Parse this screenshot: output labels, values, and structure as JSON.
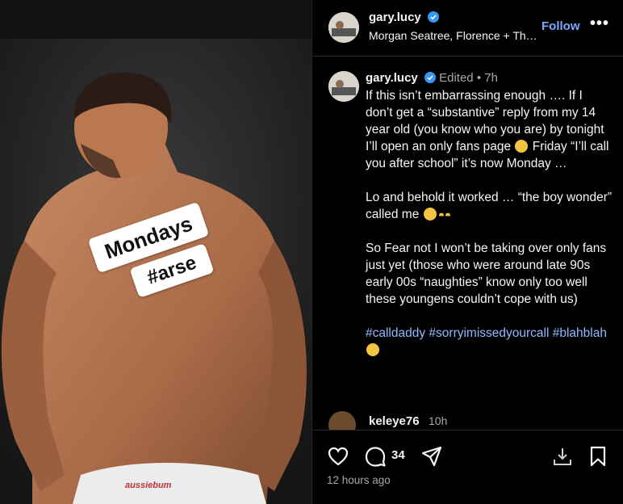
{
  "post": {
    "sticker_line1": "Mondays",
    "sticker_line2": "#arse"
  },
  "header": {
    "username": "gary.lucy",
    "location": "Morgan Seatree, Florence + Th…",
    "follow_label": "Follow",
    "more_label": "•••"
  },
  "caption": {
    "username": "gary.lucy",
    "edited": "Edited",
    "separator": "•",
    "time": "7h",
    "para1": "If this isn’t embarrassing enough …. If I don’t get a “substantive” reply from my 14 year old (you know who you are) by tonight I’ll open an only fans page",
    "para1b": "Friday “I’ll call you after school” it’s now Monday …",
    "para2": "Lo and behold it worked … “the boy wonder” called me",
    "para3": "So Fear not I won’t be taking over only fans just yet (those who were around late 90s early 00s “naughties” know only too well these youngens couldn’t cope with us)",
    "hashtags": "#calldaddy #sorryimissedyourcall #blahblah"
  },
  "comment": {
    "username": "keleye76",
    "time": "10h"
  },
  "actions": {
    "comment_count": "34",
    "timestamp": "12 hours ago"
  },
  "colors": {
    "accent": "#7aa9ff",
    "verified": "#3797f0",
    "hashtag": "#8fb8ff",
    "muted": "#a8a8a8"
  },
  "icons": [
    "verified-badge-icon",
    "more-icon",
    "heart-icon",
    "comment-icon",
    "share-icon",
    "download-icon",
    "bookmark-icon"
  ]
}
